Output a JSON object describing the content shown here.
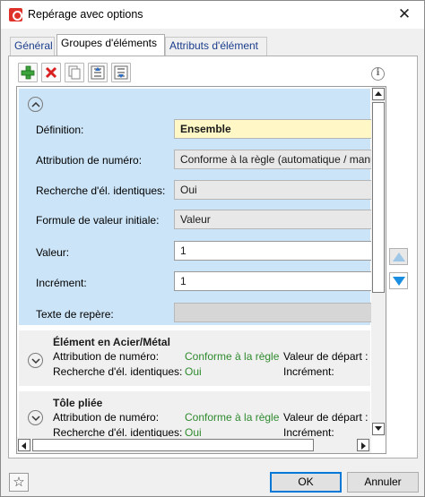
{
  "window": {
    "title": "Repérage avec options",
    "close_glyph": "✕"
  },
  "tabs": [
    {
      "label": "Général",
      "active": false
    },
    {
      "label": "Groupes d'éléments",
      "active": true
    },
    {
      "label": "Attributs d'élément",
      "active": false
    }
  ],
  "toolbar": {
    "buttons": [
      "add-icon",
      "delete-icon",
      "copy-icon",
      "move-up-list-icon",
      "move-down-list-icon"
    ],
    "info_glyph": "i"
  },
  "definition_panel": {
    "rows": [
      {
        "label": "Définition:",
        "value": "Ensemble",
        "style": "highlight"
      },
      {
        "label": "Attribution de numéro:",
        "value": "Conforme à la règle (automatique / manuelle)",
        "style": "combo"
      },
      {
        "label": "Recherche d'él. identiques:",
        "value": "Oui",
        "style": "combo"
      },
      {
        "label": "Formule de valeur initiale:",
        "value": "Valeur",
        "style": "combo"
      },
      {
        "label": "Valeur:",
        "value": "1",
        "style": "text"
      },
      {
        "label": "Incrément:",
        "value": "1",
        "style": "text"
      },
      {
        "label": "Texte de repère:",
        "value": "",
        "style": "readonly"
      }
    ]
  },
  "groups": [
    {
      "title": "Élément en Acier/Métal",
      "numbering_label": "Attribution de numéro:",
      "numbering_value": "Conforme à la règle",
      "search_label": "Recherche d'él. identiques:",
      "search_value": "Oui",
      "start_label": "Valeur de départ :",
      "increment_label": "Incrément:"
    },
    {
      "title": "Tôle pliée",
      "numbering_label": "Attribution de numéro:",
      "numbering_value": "Conforme à la règle",
      "search_label": "Recherche d'él. identiques:",
      "search_value": "Oui",
      "start_label": "Valeur de départ :",
      "increment_label": "Incrément:"
    }
  ],
  "footer": {
    "favorites_glyph": "☆",
    "ok_label": "OK",
    "cancel_label": "Annuler"
  },
  "colors": {
    "accent": "#0078d7",
    "panel_blue": "#cce4f7",
    "highlight_yellow": "#fff8c6",
    "value_green": "#2e8a2e"
  }
}
